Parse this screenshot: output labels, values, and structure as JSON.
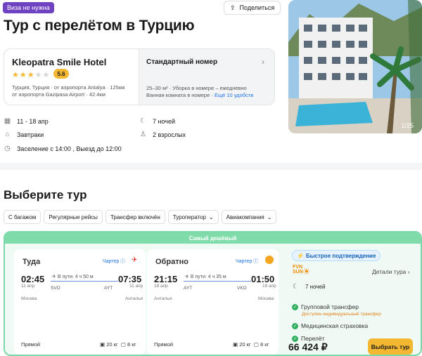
{
  "visa_badge": "Виза не нужна",
  "share_label": "Поделиться",
  "title": "Тур с перелётом в Турцию",
  "photo": {
    "counter": "1/25"
  },
  "hotel": {
    "name": "Kleopatra Smile Hotel",
    "stars": 3,
    "stars_text": "★★★★★",
    "rating": "5.6",
    "location_line1": "Турция, Турция · от аэропорта Antalya · 125км",
    "location_line2": "от аэропорта Gazipasa Airport · 42.4км"
  },
  "room": {
    "name": "Стандартный номер",
    "details_line1": "25–30 м² · Уборка в номере – ежедневно",
    "details_line2": "Ванная комната в номере ·",
    "more": "Ещё 10 удобств"
  },
  "info": {
    "dates": "11 - 18 апр",
    "nights": "7 ночей",
    "meal": "Завтраки",
    "guests": "2 взрослых",
    "checkin": "Заселение с 14:00 , Выезд до 12:00"
  },
  "choose_title": "Выберите тур",
  "filters": [
    {
      "label": "С багажом"
    },
    {
      "label": "Регулярные рейсы"
    },
    {
      "label": "Трансфер включён"
    },
    {
      "label": "Туроператор"
    },
    {
      "label": "Авиакомпания"
    }
  ],
  "offer": {
    "cheapest_label": "Самый дешёвый",
    "outbound": {
      "title": "Туда",
      "charter": "Чартер",
      "dep_time": "02:45",
      "arr_time": "07:35",
      "duration": "В пути: 4 ч 50 м",
      "dep_date": "11 апр",
      "arr_date": "11 апр",
      "dep_code": "SVO",
      "arr_code": "AYT",
      "dep_city": "Москва",
      "arr_city": "Анталья",
      "direct": "Прямой",
      "bag1": "20 кг",
      "bag2": "8 кг"
    },
    "return": {
      "title": "Обратно",
      "charter": "Чартер",
      "dep_time": "21:15",
      "arr_time": "01:50",
      "duration": "В пути: 4 ч 35 м",
      "dep_date": "18 апр",
      "arr_date": "19 апр",
      "dep_code": "AYT",
      "arr_code": "VKO",
      "dep_city": "Анталья",
      "arr_city": "Москва",
      "direct": "Прямой",
      "bag1": "20 кг",
      "bag2": "8 кг"
    },
    "fast_confirm": "Быстрое подтверждение",
    "operator_logo_line1": "FVN",
    "operator_logo_line2": "SUN",
    "tour_details": "Детали тура",
    "nights": "7 ночей",
    "features": [
      "Групповой трансфер",
      "Медицинская страховка",
      "Перелёт"
    ],
    "transfer_note": "Доступен индивидуальный трансфер",
    "price": "66 424 ₽",
    "buy_label": "Выбрать тур"
  },
  "colors": {
    "accent": "#f4b731",
    "green": "#31b05f",
    "visa": "#6f42c1",
    "link": "#1b73e8"
  }
}
